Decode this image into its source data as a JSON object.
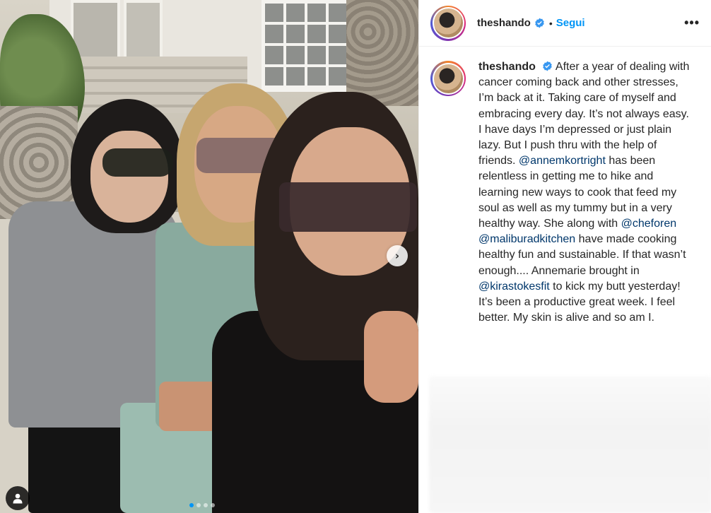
{
  "post": {
    "username": "theshando",
    "follow_label": "Segui",
    "separator": "•",
    "more_label": "•••",
    "carousel_next": "›",
    "carousel_total": 4,
    "carousel_active": 1
  },
  "caption": {
    "username": "theshando",
    "segments": [
      {
        "text": "After a year of dealing with cancer coming back and other stresses, I’m back at it. Taking care of myself and embracing every day. It’s not always easy. I have days I’m depressed or just plain lazy. But I push thru with the help of friends. ",
        "type": "text"
      },
      {
        "text": "@annemkortright",
        "type": "mention"
      },
      {
        "text": " has been relentless in getting me to hike and learning new ways to cook that feed my soul as well as my tummy but in a very healthy way. She along with ",
        "type": "text"
      },
      {
        "text": "@cheforen",
        "type": "mention"
      },
      {
        "text": " ",
        "type": "text"
      },
      {
        "text": "@maliburadkitchen",
        "type": "mention"
      },
      {
        "text": " have made cooking healthy fun and sustainable. If that wasn’t enough.... Annemarie brought in ",
        "type": "text"
      },
      {
        "text": "@kirastokesfit",
        "type": "mention"
      },
      {
        "text": " to kick my butt yesterday! It’s been a productive great week. I feel better. My skin is alive and so am I.",
        "type": "text"
      }
    ]
  },
  "colors": {
    "accent": "#0095f6",
    "mention": "#00376b",
    "verified": "#3897f0",
    "text": "#262626"
  },
  "icons": {
    "verified": "verified-badge-icon",
    "user_tag": "user-tag-icon",
    "next": "chevron-right-icon",
    "more": "more-options-icon"
  }
}
